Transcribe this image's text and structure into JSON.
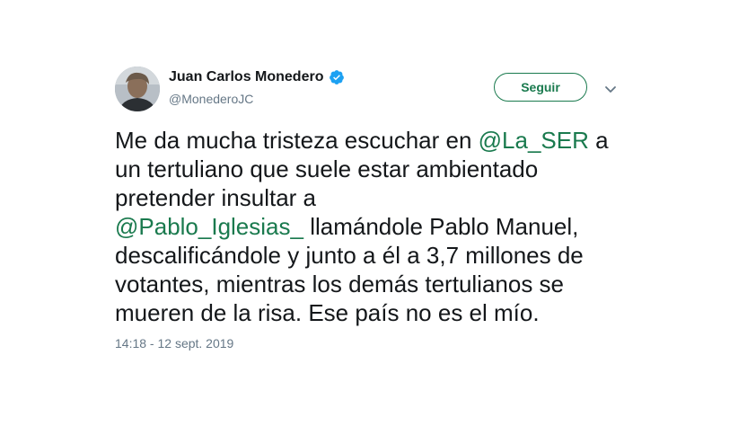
{
  "author": {
    "name": "Juan Carlos Monedero",
    "handle": "@MonederoJC"
  },
  "actions": {
    "follow_label": "Seguir"
  },
  "tweet": {
    "lines": [
      [
        {
          "text": "Me da mucha tristeza escuchar en "
        },
        {
          "text": "@La_SER",
          "mention": true
        },
        {
          "text": " a"
        }
      ],
      [
        {
          "text": "un tertuliano que suele estar ambientado"
        }
      ],
      [
        {
          "text": "pretender insultar a"
        }
      ],
      [
        {
          "text": "@Pablo_Iglesias_",
          "mention": true
        },
        {
          "text": " llamándole Pablo Manuel,"
        }
      ],
      [
        {
          "text": "descalificándole y junto a él a 3,7 millones de"
        }
      ],
      [
        {
          "text": "votantes, mientras los demás tertulianos se"
        }
      ],
      [
        {
          "text": "mueren de la risa. Ese país no es el mío."
        }
      ]
    ],
    "timestamp": "14:18 - 12 sept. 2019"
  },
  "colors": {
    "accent": "#1a7a4e",
    "verified": "#1da1f2",
    "secondary_text": "#657786"
  },
  "icons": {
    "verified": "verified-badge-icon",
    "caret": "chevron-down-icon"
  }
}
